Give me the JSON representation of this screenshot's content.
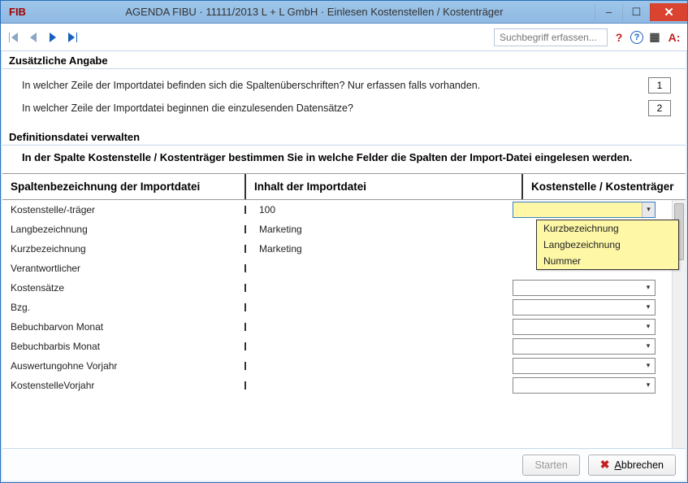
{
  "titlebar": {
    "app": "FIB",
    "title": "AGENDA FIBU · 11111/2013 L + L GmbH · Einlesen Kostenstellen / Kostenträger"
  },
  "toolbar": {
    "search_placeholder": "Suchbegriff erfassen..."
  },
  "section1": {
    "title": "Zusätzliche Angabe",
    "row1_label": "In welcher Zeile der Importdatei befinden sich die Spaltenüberschriften? Nur erfassen falls vorhanden.",
    "row1_value": "1",
    "row2_label": "In welcher Zeile der Importdatei beginnen die einzulesenden Datensätze?",
    "row2_value": "2"
  },
  "section2": {
    "title": "Definitionsdatei verwalten",
    "instruction": "In der Spalte Kostenstelle / Kostenträger bestimmen Sie in welche Felder die Spalten der Import-Datei eingelesen werden."
  },
  "grid": {
    "headers": {
      "c1": "Spaltenbezeichnung der Importdatei",
      "c2": "Inhalt der Importdatei",
      "c3": "Kostenstelle / Kostenträger"
    },
    "rows": [
      {
        "c1": "Kostenstelle/-träger",
        "c2": "100"
      },
      {
        "c1": "Langbezeichnung",
        "c2": "Marketing"
      },
      {
        "c1": "Kurzbezeichnung",
        "c2": "Marketing"
      },
      {
        "c1": "Verantwortlicher",
        "c2": ""
      },
      {
        "c1": "Kostensätze",
        "c2": ""
      },
      {
        "c1": "Bzg.",
        "c2": ""
      },
      {
        "c1": "Bebuchbarvon Monat",
        "c2": ""
      },
      {
        "c1": "Bebuchbarbis Monat",
        "c2": ""
      },
      {
        "c1": "Auswertungohne Vorjahr",
        "c2": ""
      },
      {
        "c1": "KostenstelleVorjahr",
        "c2": ""
      }
    ],
    "dropdown_options": [
      "Kurzbezeichnung",
      "Langbezeichnung",
      "Nummer"
    ]
  },
  "footer": {
    "start": "Starten",
    "cancel": "Abbrechen"
  }
}
